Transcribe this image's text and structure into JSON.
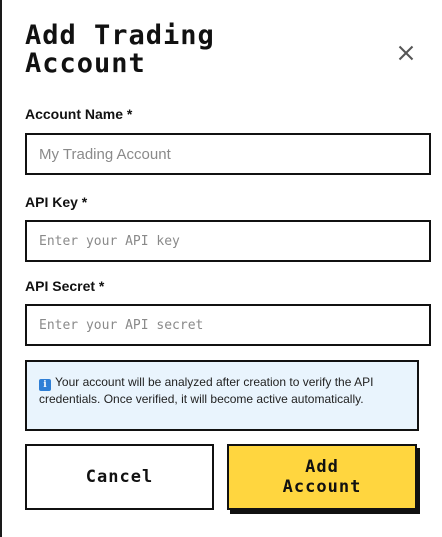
{
  "dialog": {
    "title": "Add Trading\nAccount",
    "close_icon": "close-icon"
  },
  "form": {
    "account_name": {
      "label": "Account Name *",
      "placeholder": "My Trading Account",
      "value": ""
    },
    "api_key": {
      "label": "API Key *",
      "placeholder": "Enter your API key",
      "value": ""
    },
    "api_secret": {
      "label": "API Secret *",
      "placeholder": "Enter your API secret",
      "value": ""
    }
  },
  "info": {
    "icon": "info-icon",
    "text": "Your account will be analyzed after creation to verify the API credentials. Once verified, it will become active automatically."
  },
  "actions": {
    "cancel_label": "Cancel",
    "submit_label": "Add\nAccount"
  },
  "colors": {
    "primary_button": "#ffd63f",
    "info_background": "#e9f4fd",
    "border": "#111111",
    "info_icon": "#2f7fd6"
  }
}
